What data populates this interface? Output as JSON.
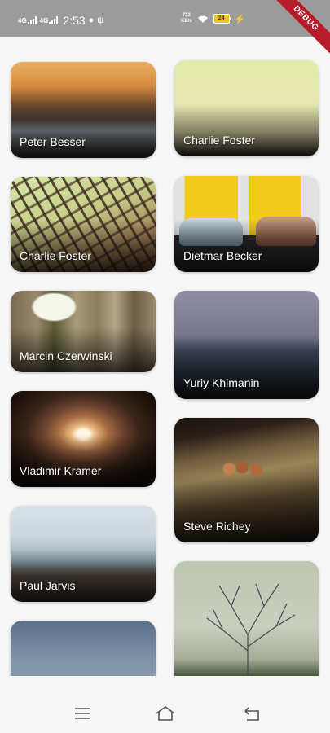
{
  "status_bar": {
    "signal1": "4G",
    "signal2": "4G",
    "time": "2:53",
    "net_speed_value": "733",
    "net_speed_unit": "KB/s",
    "battery": "24",
    "debug_banner": "DEBUG"
  },
  "cards": [
    {
      "name": "Peter Besser"
    },
    {
      "name": "Charlie Foster"
    },
    {
      "name": "Charlie Foster"
    },
    {
      "name": "Dietmar Becker"
    },
    {
      "name": "Marcin Czerwinski"
    },
    {
      "name": "Yuriy Khimanin"
    },
    {
      "name": "Vladimir Kramer"
    },
    {
      "name": "Steve Richey"
    },
    {
      "name": "Paul Jarvis"
    },
    {
      "name": ""
    },
    {
      "name": ""
    }
  ],
  "nav": {
    "icons": [
      "menu-icon",
      "home-icon",
      "back-icon"
    ]
  }
}
